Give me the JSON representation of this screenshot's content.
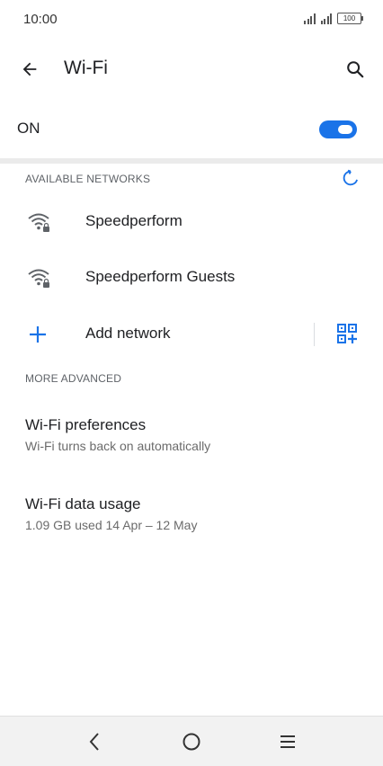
{
  "status_bar": {
    "time": "10:00",
    "battery": "100"
  },
  "app_bar": {
    "title": "Wi-Fi"
  },
  "master_switch": {
    "label": "ON",
    "state": "on"
  },
  "available_networks": {
    "header": "AVAILABLE NETWORKS",
    "networks": [
      {
        "name": "Speedperform",
        "secured": true
      },
      {
        "name": "Speedperform Guests",
        "secured": true
      }
    ],
    "add_network_label": "Add network"
  },
  "more_advanced": {
    "header": "MORE ADVANCED",
    "items": [
      {
        "title": "Wi-Fi preferences",
        "subtitle": "Wi-Fi turns back on automatically"
      },
      {
        "title": "Wi-Fi data usage",
        "subtitle": "1.09 GB used 14 Apr – 12 May"
      }
    ]
  },
  "colors": {
    "accent": "#1a73e8",
    "icon_gray": "#5f6368",
    "nav_bg": "#f2f2f2"
  }
}
